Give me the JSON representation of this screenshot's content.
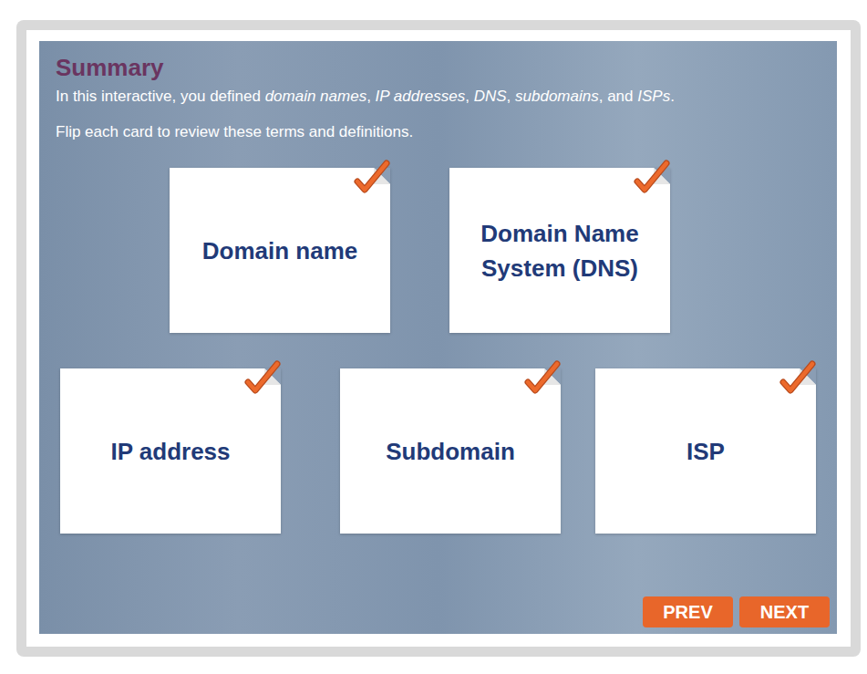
{
  "title": "Summary",
  "intro": [
    {
      "text": "In this interactive, you defined ",
      "italic": false
    },
    {
      "text": "domain names",
      "italic": true
    },
    {
      "text": ", ",
      "italic": false
    },
    {
      "text": "IP addresses",
      "italic": true
    },
    {
      "text": ", ",
      "italic": false
    },
    {
      "text": "DNS",
      "italic": true
    },
    {
      "text": ", ",
      "italic": false
    },
    {
      "text": "subdomains",
      "italic": true
    },
    {
      "text": ", and ",
      "italic": false
    },
    {
      "text": "ISPs",
      "italic": true
    },
    {
      "text": ".",
      "italic": false
    }
  ],
  "hint": "Flip each card to review these terms and definitions.",
  "cards": [
    {
      "label": "Domain name",
      "checked": true
    },
    {
      "label": "Domain Name System (DNS)",
      "checked": true
    },
    {
      "label": "IP address",
      "checked": true
    },
    {
      "label": "Subdomain",
      "checked": true
    },
    {
      "label": "ISP",
      "checked": true
    }
  ],
  "buttons": [
    "PREV",
    "NEXT"
  ]
}
